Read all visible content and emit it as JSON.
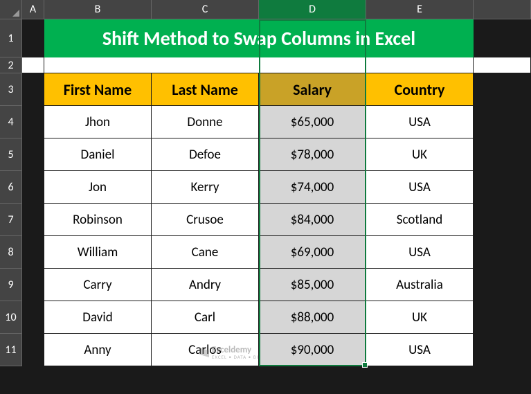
{
  "columns": [
    "",
    "A",
    "B",
    "C",
    "D",
    "E",
    ""
  ],
  "selected_column_index": 4,
  "title": "Shift Method to Swap Columns in Excel",
  "headers": [
    "First Name",
    "Last Name",
    "Salary",
    "Country"
  ],
  "rows": [
    {
      "num": "1"
    },
    {
      "num": "2"
    },
    {
      "num": "3"
    },
    {
      "num": "4",
      "data": [
        "Jhon",
        "Donne",
        "$65,000",
        "USA"
      ]
    },
    {
      "num": "5",
      "data": [
        "Daniel",
        "Defoe",
        "$78,000",
        "UK"
      ]
    },
    {
      "num": "6",
      "data": [
        "Jon",
        "Kerry",
        "$74,000",
        "USA"
      ]
    },
    {
      "num": "7",
      "data": [
        "Robinson",
        "Crusoe",
        "$84,000",
        "Scotland"
      ]
    },
    {
      "num": "8",
      "data": [
        "William",
        "Cane",
        "$69,000",
        "USA"
      ]
    },
    {
      "num": "9",
      "data": [
        "Carry",
        "Andry",
        "$85,000",
        "Australia"
      ]
    },
    {
      "num": "10",
      "data": [
        "David",
        "Carl",
        "$88,000",
        "UK"
      ]
    },
    {
      "num": "11",
      "data": [
        "Anny",
        "Carlos",
        "$90,000",
        "USA"
      ]
    }
  ],
  "watermark": {
    "brand": "Exceldemy",
    "tagline": "EXCEL • DATA • BI"
  },
  "chart_data": {
    "type": "table",
    "title": "Shift Method to Swap Columns in Excel",
    "columns": [
      "First Name",
      "Last Name",
      "Salary",
      "Country"
    ],
    "selected_column": "Salary",
    "data": [
      {
        "First Name": "Jhon",
        "Last Name": "Donne",
        "Salary": 65000,
        "Country": "USA"
      },
      {
        "First Name": "Daniel",
        "Last Name": "Defoe",
        "Salary": 78000,
        "Country": "UK"
      },
      {
        "First Name": "Jon",
        "Last Name": "Kerry",
        "Salary": 74000,
        "Country": "USA"
      },
      {
        "First Name": "Robinson",
        "Last Name": "Crusoe",
        "Salary": 84000,
        "Country": "Scotland"
      },
      {
        "First Name": "William",
        "Last Name": "Cane",
        "Salary": 69000,
        "Country": "USA"
      },
      {
        "First Name": "Carry",
        "Last Name": "Andry",
        "Salary": 85000,
        "Country": "Australia"
      },
      {
        "First Name": "David",
        "Last Name": "Carl",
        "Salary": 88000,
        "Country": "UK"
      },
      {
        "First Name": "Anny",
        "Last Name": "Carlos",
        "Salary": 90000,
        "Country": "USA"
      }
    ]
  }
}
